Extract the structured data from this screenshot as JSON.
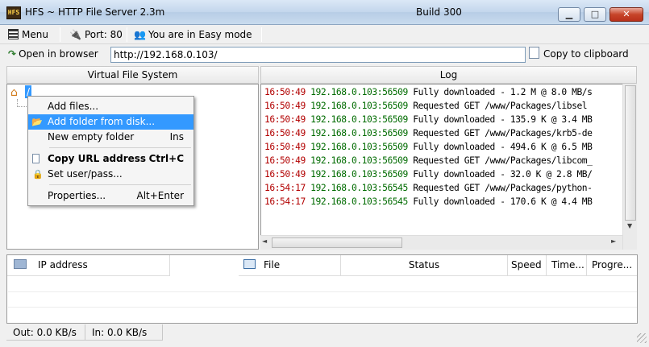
{
  "window": {
    "title": "HFS ~ HTTP File Server 2.3m",
    "build": "Build 300",
    "icon_text": "HFS",
    "controls": [
      "minimize",
      "maximize",
      "close"
    ]
  },
  "toolbar": {
    "menu_label": "Menu",
    "port_label": "Port: 80",
    "mode_label": "You are in Easy mode"
  },
  "urlbar": {
    "open_label": "Open in browser",
    "url_value": "http://192.168.0.103/",
    "copy_label": "Copy to clipboard"
  },
  "vfs": {
    "header": "Virtual File System",
    "root_label": "/"
  },
  "context_menu": {
    "items": [
      {
        "label": "Add files...",
        "shortcut": "",
        "selected": false
      },
      {
        "label": "Add folder from disk...",
        "shortcut": "",
        "selected": true
      },
      {
        "label": "New empty folder",
        "shortcut": "Ins",
        "selected": false
      },
      {
        "label": "Copy URL address",
        "shortcut": "Ctrl+C",
        "selected": false,
        "bold": true
      },
      {
        "label": "Set user/pass...",
        "shortcut": "",
        "selected": false
      },
      {
        "label": "Properties...",
        "shortcut": "Alt+Enter",
        "selected": false
      }
    ]
  },
  "log": {
    "header": "Log",
    "lines": [
      {
        "time": "16:50:49",
        "addr": "192.168.0.103:56509",
        "msg": "Fully downloaded - 1.2 M @ 8.0 MB/s"
      },
      {
        "time": "16:50:49",
        "addr": "192.168.0.103:56509",
        "msg": "Requested GET /www/Packages/libsel"
      },
      {
        "time": "16:50:49",
        "addr": "192.168.0.103:56509",
        "msg": "Fully downloaded - 135.9 K @ 3.4 MB"
      },
      {
        "time": "16:50:49",
        "addr": "192.168.0.103:56509",
        "msg": "Requested GET /www/Packages/krb5-de"
      },
      {
        "time": "16:50:49",
        "addr": "192.168.0.103:56509",
        "msg": "Fully downloaded - 494.6 K @ 6.5 MB"
      },
      {
        "time": "16:50:49",
        "addr": "192.168.0.103:56509",
        "msg": "Requested GET /www/Packages/libcom_"
      },
      {
        "time": "16:50:49",
        "addr": "192.168.0.103:56509",
        "msg": "Fully downloaded - 32.0 K @ 2.8 MB/"
      },
      {
        "time": "16:54:17",
        "addr": "192.168.0.103:56545",
        "msg": "Requested GET /www/Packages/python-"
      },
      {
        "time": "16:54:17",
        "addr": "192.168.0.103:56545",
        "msg": "Fully downloaded - 170.6 K @ 4.4 MB"
      }
    ]
  },
  "connections": {
    "columns": [
      "IP address",
      "File",
      "Status",
      "Speed",
      "Time...",
      "Progre..."
    ]
  },
  "statusbar": {
    "out_label": "Out: 0.0 KB/s",
    "in_label": "In: 0.0 KB/s"
  },
  "colors": {
    "log_time": "#b20000",
    "log_addr": "#006b00",
    "selection": "#3399ff"
  }
}
